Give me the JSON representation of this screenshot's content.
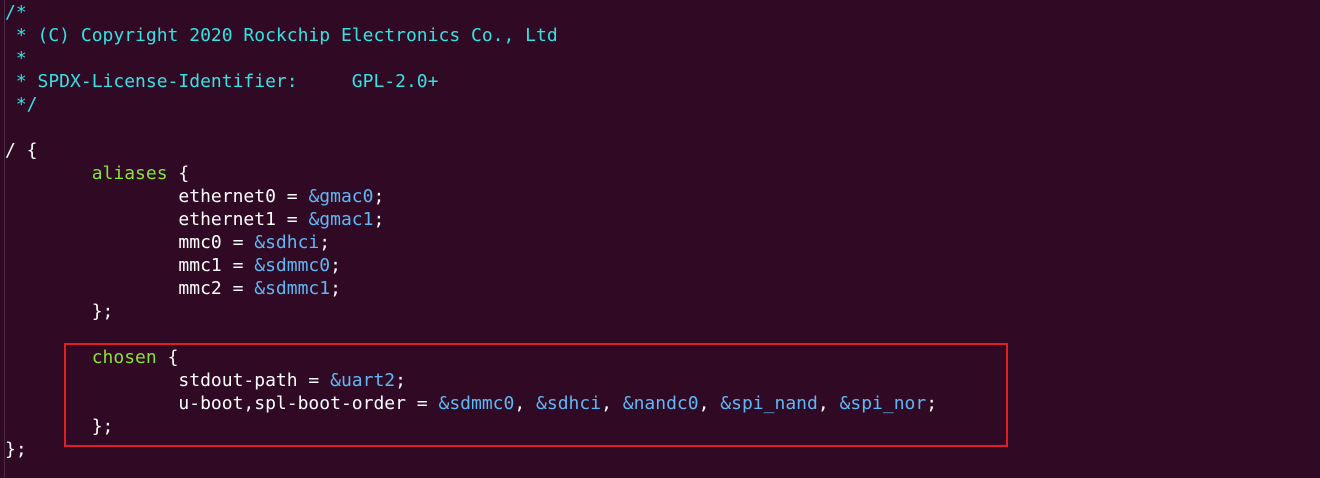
{
  "editor": {
    "background": "#300a24",
    "highlight_color": "#e02020",
    "colors": {
      "comment": "#34e2e2",
      "reference": "#5fb7f5",
      "node_name": "#8ae234",
      "text": "#ffffff"
    },
    "lines": [
      {
        "segments": [
          {
            "t": "/*",
            "c": "comment"
          }
        ]
      },
      {
        "segments": [
          {
            "t": " * (C) Copyright 2020 Rockchip Electronics Co., Ltd",
            "c": "comment"
          }
        ]
      },
      {
        "segments": [
          {
            "t": " *",
            "c": "comment"
          }
        ]
      },
      {
        "segments": [
          {
            "t": " * SPDX-License-Identifier:     GPL-2.0+",
            "c": "comment"
          }
        ]
      },
      {
        "segments": [
          {
            "t": " */",
            "c": "comment"
          }
        ]
      },
      {
        "segments": [
          {
            "t": "",
            "c": "plain"
          }
        ]
      },
      {
        "segments": [
          {
            "t": "/ {",
            "c": "plain"
          }
        ]
      },
      {
        "segments": [
          {
            "t": "        ",
            "c": "plain"
          },
          {
            "t": "aliases",
            "c": "node"
          },
          {
            "t": " {",
            "c": "plain"
          }
        ]
      },
      {
        "segments": [
          {
            "t": "                ethernet0 = ",
            "c": "plain"
          },
          {
            "t": "&gmac0",
            "c": "ref"
          },
          {
            "t": ";",
            "c": "plain"
          }
        ]
      },
      {
        "segments": [
          {
            "t": "                ethernet1 = ",
            "c": "plain"
          },
          {
            "t": "&gmac1",
            "c": "ref"
          },
          {
            "t": ";",
            "c": "plain"
          }
        ]
      },
      {
        "segments": [
          {
            "t": "                mmc0 = ",
            "c": "plain"
          },
          {
            "t": "&sdhci",
            "c": "ref"
          },
          {
            "t": ";",
            "c": "plain"
          }
        ]
      },
      {
        "segments": [
          {
            "t": "                mmc1 = ",
            "c": "plain"
          },
          {
            "t": "&sdmmc0",
            "c": "ref"
          },
          {
            "t": ";",
            "c": "plain"
          }
        ]
      },
      {
        "segments": [
          {
            "t": "                mmc2 = ",
            "c": "plain"
          },
          {
            "t": "&sdmmc1",
            "c": "ref"
          },
          {
            "t": ";",
            "c": "plain"
          }
        ]
      },
      {
        "segments": [
          {
            "t": "        };",
            "c": "plain"
          }
        ]
      },
      {
        "segments": [
          {
            "t": "",
            "c": "plain"
          }
        ]
      },
      {
        "segments": [
          {
            "t": "        ",
            "c": "plain"
          },
          {
            "t": "chosen",
            "c": "node"
          },
          {
            "t": " {",
            "c": "plain"
          }
        ]
      },
      {
        "segments": [
          {
            "t": "                stdout-path = ",
            "c": "plain"
          },
          {
            "t": "&uart2",
            "c": "ref"
          },
          {
            "t": ";",
            "c": "plain"
          }
        ]
      },
      {
        "segments": [
          {
            "t": "                u-boot,spl-boot-order = ",
            "c": "plain"
          },
          {
            "t": "&sdmmc0",
            "c": "ref"
          },
          {
            "t": ", ",
            "c": "plain"
          },
          {
            "t": "&sdhci",
            "c": "ref"
          },
          {
            "t": ", ",
            "c": "plain"
          },
          {
            "t": "&nandc0",
            "c": "ref"
          },
          {
            "t": ", ",
            "c": "plain"
          },
          {
            "t": "&spi_nand",
            "c": "ref"
          },
          {
            "t": ", ",
            "c": "plain"
          },
          {
            "t": "&spi_nor",
            "c": "ref"
          },
          {
            "t": ";",
            "c": "plain"
          }
        ]
      },
      {
        "segments": [
          {
            "t": "        };",
            "c": "plain"
          }
        ]
      },
      {
        "segments": [
          {
            "t": "};",
            "c": "plain"
          }
        ]
      }
    ]
  }
}
